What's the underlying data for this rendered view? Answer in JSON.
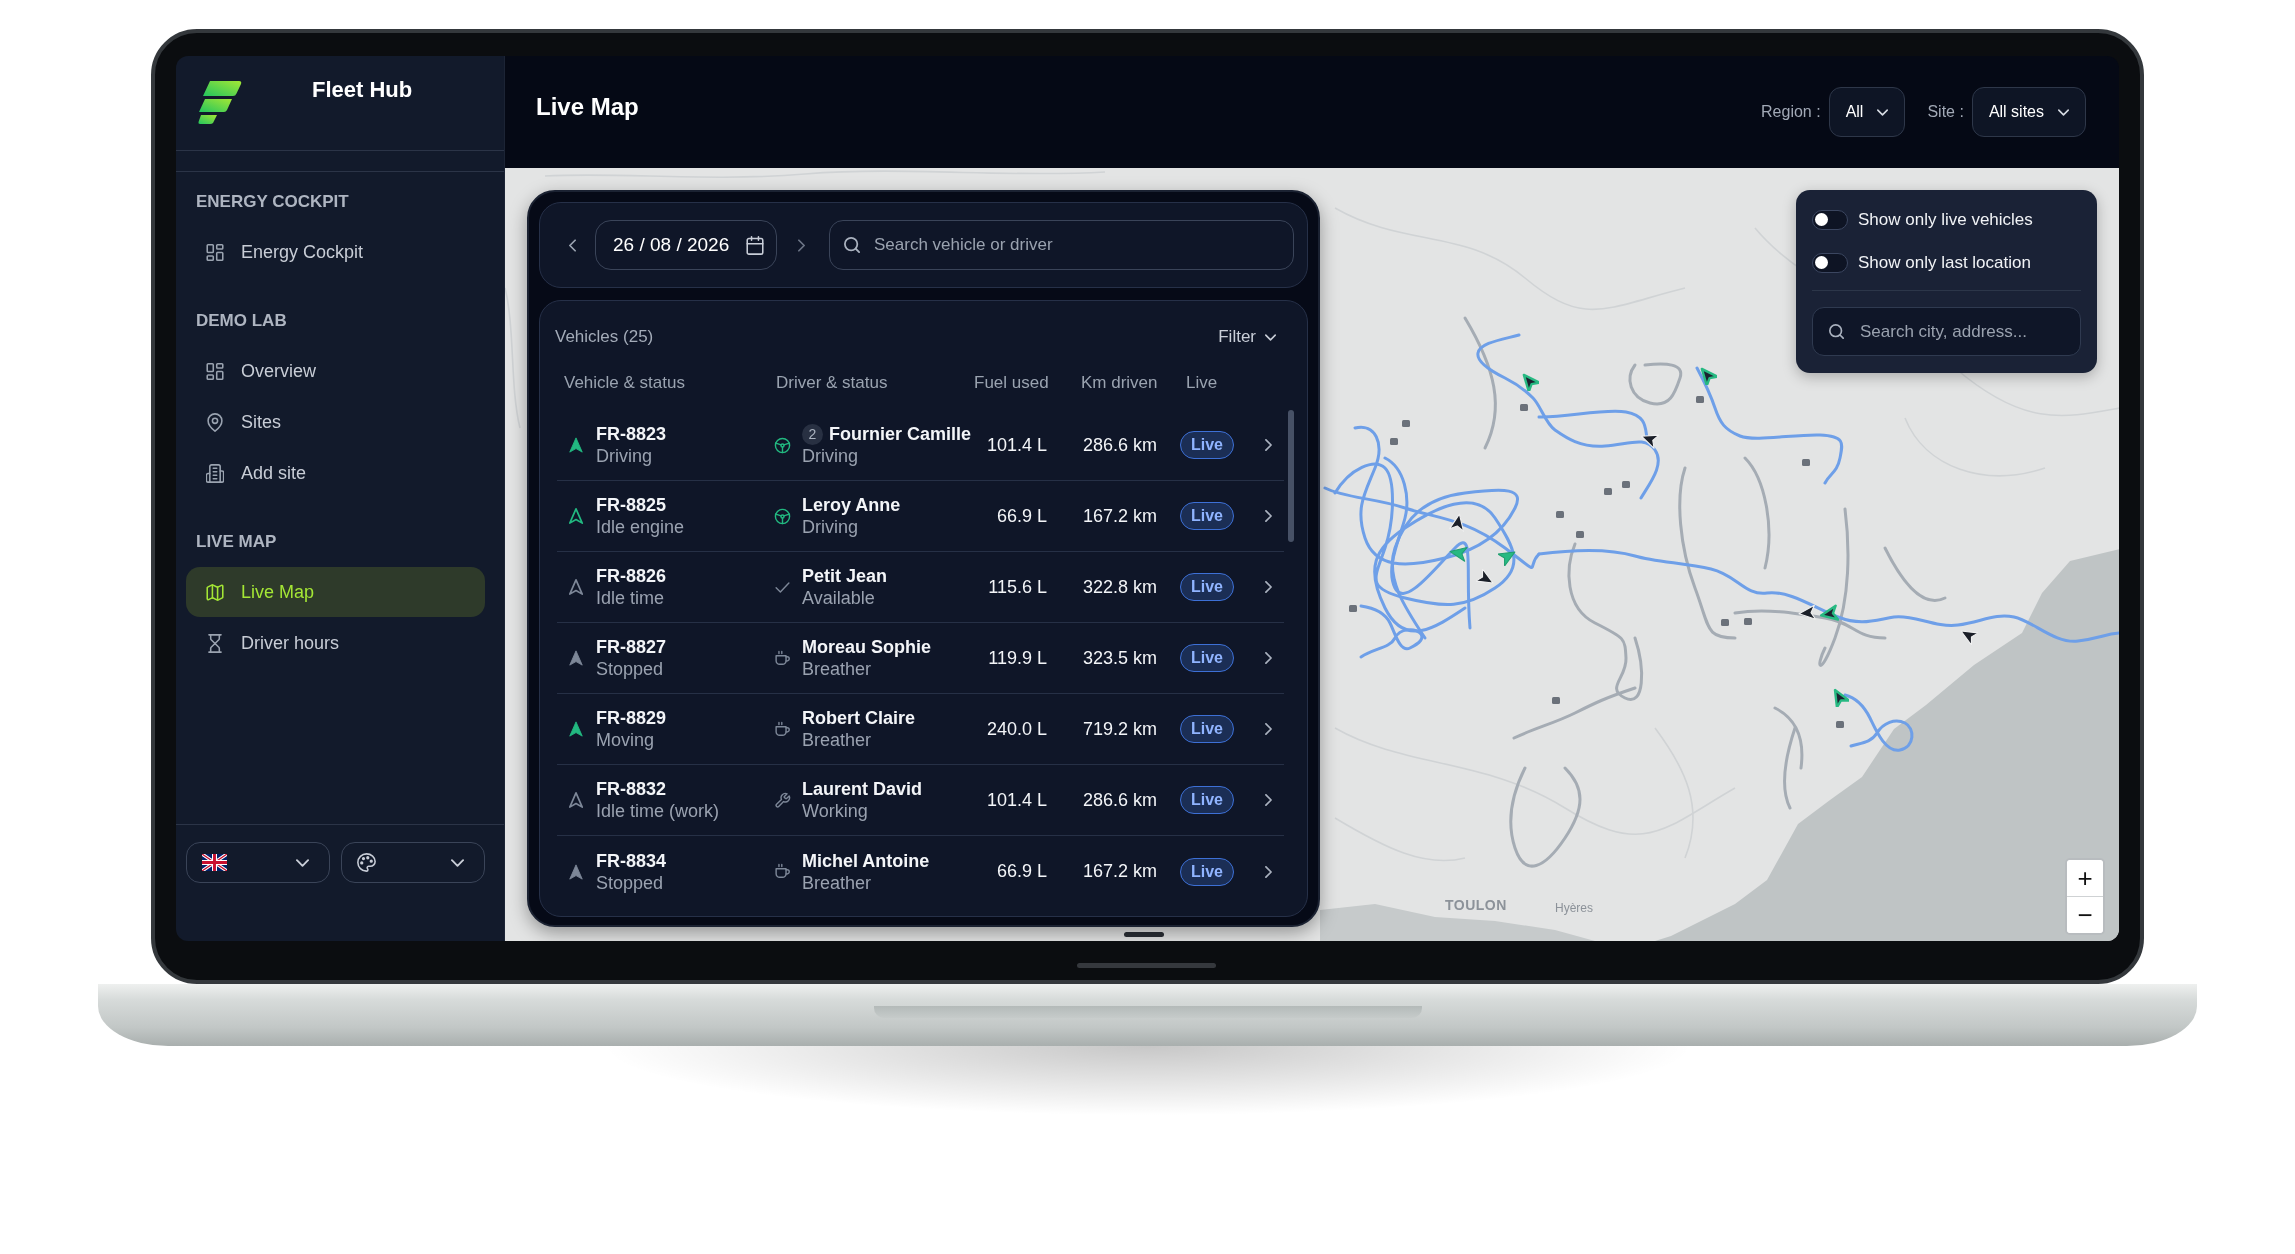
{
  "sidebar": {
    "brand": "Fleet Hub",
    "sections": [
      {
        "title": "ENERGY COCKPIT",
        "items": [
          {
            "label": "Energy Cockpit",
            "selected": false
          }
        ]
      },
      {
        "title": "DEMO LAB",
        "items": [
          {
            "label": "Overview",
            "selected": false
          },
          {
            "label": "Sites",
            "selected": false
          },
          {
            "label": "Add site",
            "selected": false
          }
        ]
      },
      {
        "title": "LIVE MAP",
        "items": [
          {
            "label": "Live Map",
            "selected": true
          },
          {
            "label": "Driver hours",
            "selected": false
          }
        ]
      }
    ]
  },
  "header": {
    "title": "Live Map",
    "filters": [
      {
        "label": "Region :",
        "value": "All"
      },
      {
        "label": "Site :",
        "value": "All sites"
      }
    ]
  },
  "panel": {
    "date": "26 / 08 / 2026",
    "search": {
      "placeholder": "Search vehicle or driver"
    },
    "vehicles": {
      "title": "Vehicles (25)",
      "filter": "Filter",
      "columns": [
        "Vehicle & status",
        "Driver & status",
        "Fuel used",
        "Km driven",
        "Live"
      ],
      "rows": [
        {
          "vehicle": {
            "id": "FR-8823",
            "status": "Driving",
            "kind": "moving"
          },
          "driver": {
            "name": "Fournier Camille",
            "status": "Driving",
            "kind": "driving",
            "badge": "2"
          },
          "fuel": "101.4 L",
          "km": "286.6 km",
          "live": "Live"
        },
        {
          "vehicle": {
            "id": "FR-8825",
            "status": "Idle engine",
            "kind": "idling"
          },
          "driver": {
            "name": "Leroy Anne",
            "status": "Driving",
            "kind": "driving"
          },
          "fuel": "66.9 L",
          "km": "167.2 km",
          "live": "Live"
        },
        {
          "vehicle": {
            "id": "FR-8826",
            "status": "Idle time",
            "kind": "idle"
          },
          "driver": {
            "name": "Petit Jean",
            "status": "Available",
            "kind": "available"
          },
          "fuel": "115.6 L",
          "km": "322.8 km",
          "live": "Live"
        },
        {
          "vehicle": {
            "id": "FR-8827",
            "status": "Stopped",
            "kind": "stopped"
          },
          "driver": {
            "name": "Moreau Sophie",
            "status": "Breather",
            "kind": "break"
          },
          "fuel": "119.9 L",
          "km": "323.5 km",
          "live": "Live"
        },
        {
          "vehicle": {
            "id": "FR-8829",
            "status": "Moving",
            "kind": "moving"
          },
          "driver": {
            "name": "Robert Claire",
            "status": "Breather",
            "kind": "break"
          },
          "fuel": "240.0 L",
          "km": "719.2 km",
          "live": "Live"
        },
        {
          "vehicle": {
            "id": "FR-8832",
            "status": "Idle time (work)",
            "kind": "idle"
          },
          "driver": {
            "name": "Laurent David",
            "status": "Working",
            "kind": "working"
          },
          "fuel": "101.4 L",
          "km": "286.6 km",
          "live": "Live"
        },
        {
          "vehicle": {
            "id": "FR-8834",
            "status": "Stopped",
            "kind": "stopped"
          },
          "driver": {
            "name": "Michel Antoine",
            "status": "Breather",
            "kind": "break"
          },
          "fuel": "66.9 L",
          "km": "167.2 km",
          "live": "Live"
        }
      ]
    }
  },
  "map": {
    "toggles": [
      {
        "label": "Show only live vehicles",
        "on": false
      },
      {
        "label": "Show only last location",
        "on": false
      }
    ],
    "search": {
      "placeholder": "Search city, address..."
    },
    "labels": [
      {
        "text": "TOULON",
        "kind": "city"
      },
      {
        "text": "Hyères",
        "kind": "town"
      }
    ],
    "zoom": [
      "+",
      "−"
    ]
  }
}
